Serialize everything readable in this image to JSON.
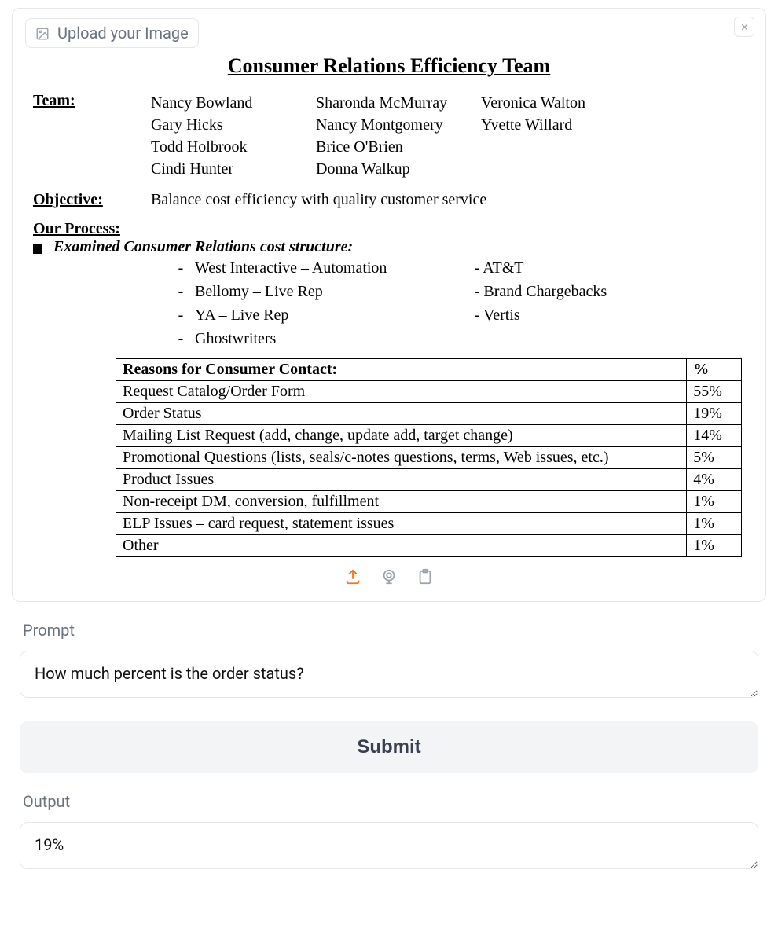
{
  "upload": {
    "label": "Upload your Image"
  },
  "document": {
    "title": "Consumer Relations Efficiency Team",
    "teamLabel": "Team:",
    "teamCol1": [
      "Nancy Bowland",
      "Gary Hicks",
      "Todd Holbrook",
      "Cindi Hunter"
    ],
    "teamCol2": [
      "Sharonda McMurray",
      "Nancy Montgomery",
      "Brice O'Brien",
      "Donna Walkup"
    ],
    "teamCol3": [
      "Veronica Walton",
      "Yvette Willard"
    ],
    "objectiveLabel": "Objective:",
    "objectiveText": "Balance cost efficiency with quality customer service",
    "processLabel": "Our Process:",
    "processSub": "Examined Consumer Relations cost structure:",
    "costLeft": [
      "West Interactive – Automation",
      "Bellomy – Live Rep",
      "YA – Live Rep",
      "Ghostwriters"
    ],
    "costRight": [
      "AT&T",
      "Brand Chargebacks",
      "Vertis"
    ],
    "tableHeaderReason": "Reasons for Consumer Contact:",
    "tableHeaderPct": "%",
    "tableRows": [
      {
        "reason": "Request Catalog/Order Form",
        "pct": "55%"
      },
      {
        "reason": "Order Status",
        "pct": "19%"
      },
      {
        "reason": "Mailing List Request (add, change, update add, target change)",
        "pct": "14%"
      },
      {
        "reason": "Promotional Questions (lists, seals/c-notes questions, terms, Web issues, etc.)",
        "pct": "5%"
      },
      {
        "reason": "Product Issues",
        "pct": "4%"
      },
      {
        "reason": "Non-receipt DM, conversion, fulfillment",
        "pct": "1%"
      },
      {
        "reason": "ELP Issues – card request, statement issues",
        "pct": "1%"
      },
      {
        "reason": "Other",
        "pct": "1%"
      }
    ]
  },
  "prompt": {
    "label": "Prompt",
    "value": "How much percent is the order status?"
  },
  "submit": {
    "label": "Submit"
  },
  "output": {
    "label": "Output",
    "value": "19%"
  },
  "chart_data": {
    "type": "table",
    "title": "Reasons for Consumer Contact",
    "categories": [
      "Request Catalog/Order Form",
      "Order Status",
      "Mailing List Request (add, change, update add, target change)",
      "Promotional Questions (lists, seals/c-notes questions, terms, Web issues, etc.)",
      "Product Issues",
      "Non-receipt DM, conversion, fulfillment",
      "ELP Issues – card request, statement issues",
      "Other"
    ],
    "values": [
      55,
      19,
      14,
      5,
      4,
      1,
      1,
      1
    ],
    "ylabel": "%"
  }
}
